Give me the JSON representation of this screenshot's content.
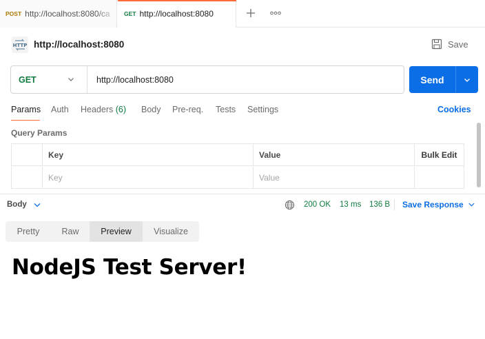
{
  "tabs": [
    {
      "method": "POST",
      "label": "http://localhost:8080/ca"
    },
    {
      "method": "GET",
      "label": "http://localhost:8080"
    }
  ],
  "request": {
    "title": "http://localhost:8080",
    "save_label": "Save",
    "method": "GET",
    "url": "http://localhost:8080",
    "send_label": "Send"
  },
  "request_tabs": {
    "params": "Params",
    "auth": "Auth",
    "headers": "Headers",
    "headers_count": "(6)",
    "body": "Body",
    "prereq": "Pre-req.",
    "tests": "Tests",
    "settings": "Settings",
    "cookies": "Cookies"
  },
  "query_params": {
    "label": "Query Params",
    "columns": {
      "key": "Key",
      "value": "Value",
      "bulk_edit": "Bulk Edit"
    },
    "placeholders": {
      "key": "Key",
      "value": "Value"
    }
  },
  "response": {
    "body_label": "Body",
    "status": "200 OK",
    "time": "13 ms",
    "size": "136 B",
    "save_response": "Save Response",
    "view_tabs": [
      "Pretty",
      "Raw",
      "Preview",
      "Visualize"
    ],
    "active_view": "Preview",
    "preview_heading": "NodeJS Test Server!"
  },
  "colors": {
    "accent_orange": "#ff6c37",
    "send_blue": "#0c6ee6",
    "get_green": "#0f7b3e",
    "post_orange": "#ad7a03"
  },
  "icons": {
    "http": "http-request-icon",
    "save": "save-disk-icon",
    "globe": "globe-icon",
    "add": "plus-icon",
    "more": "more-dots-icon"
  }
}
